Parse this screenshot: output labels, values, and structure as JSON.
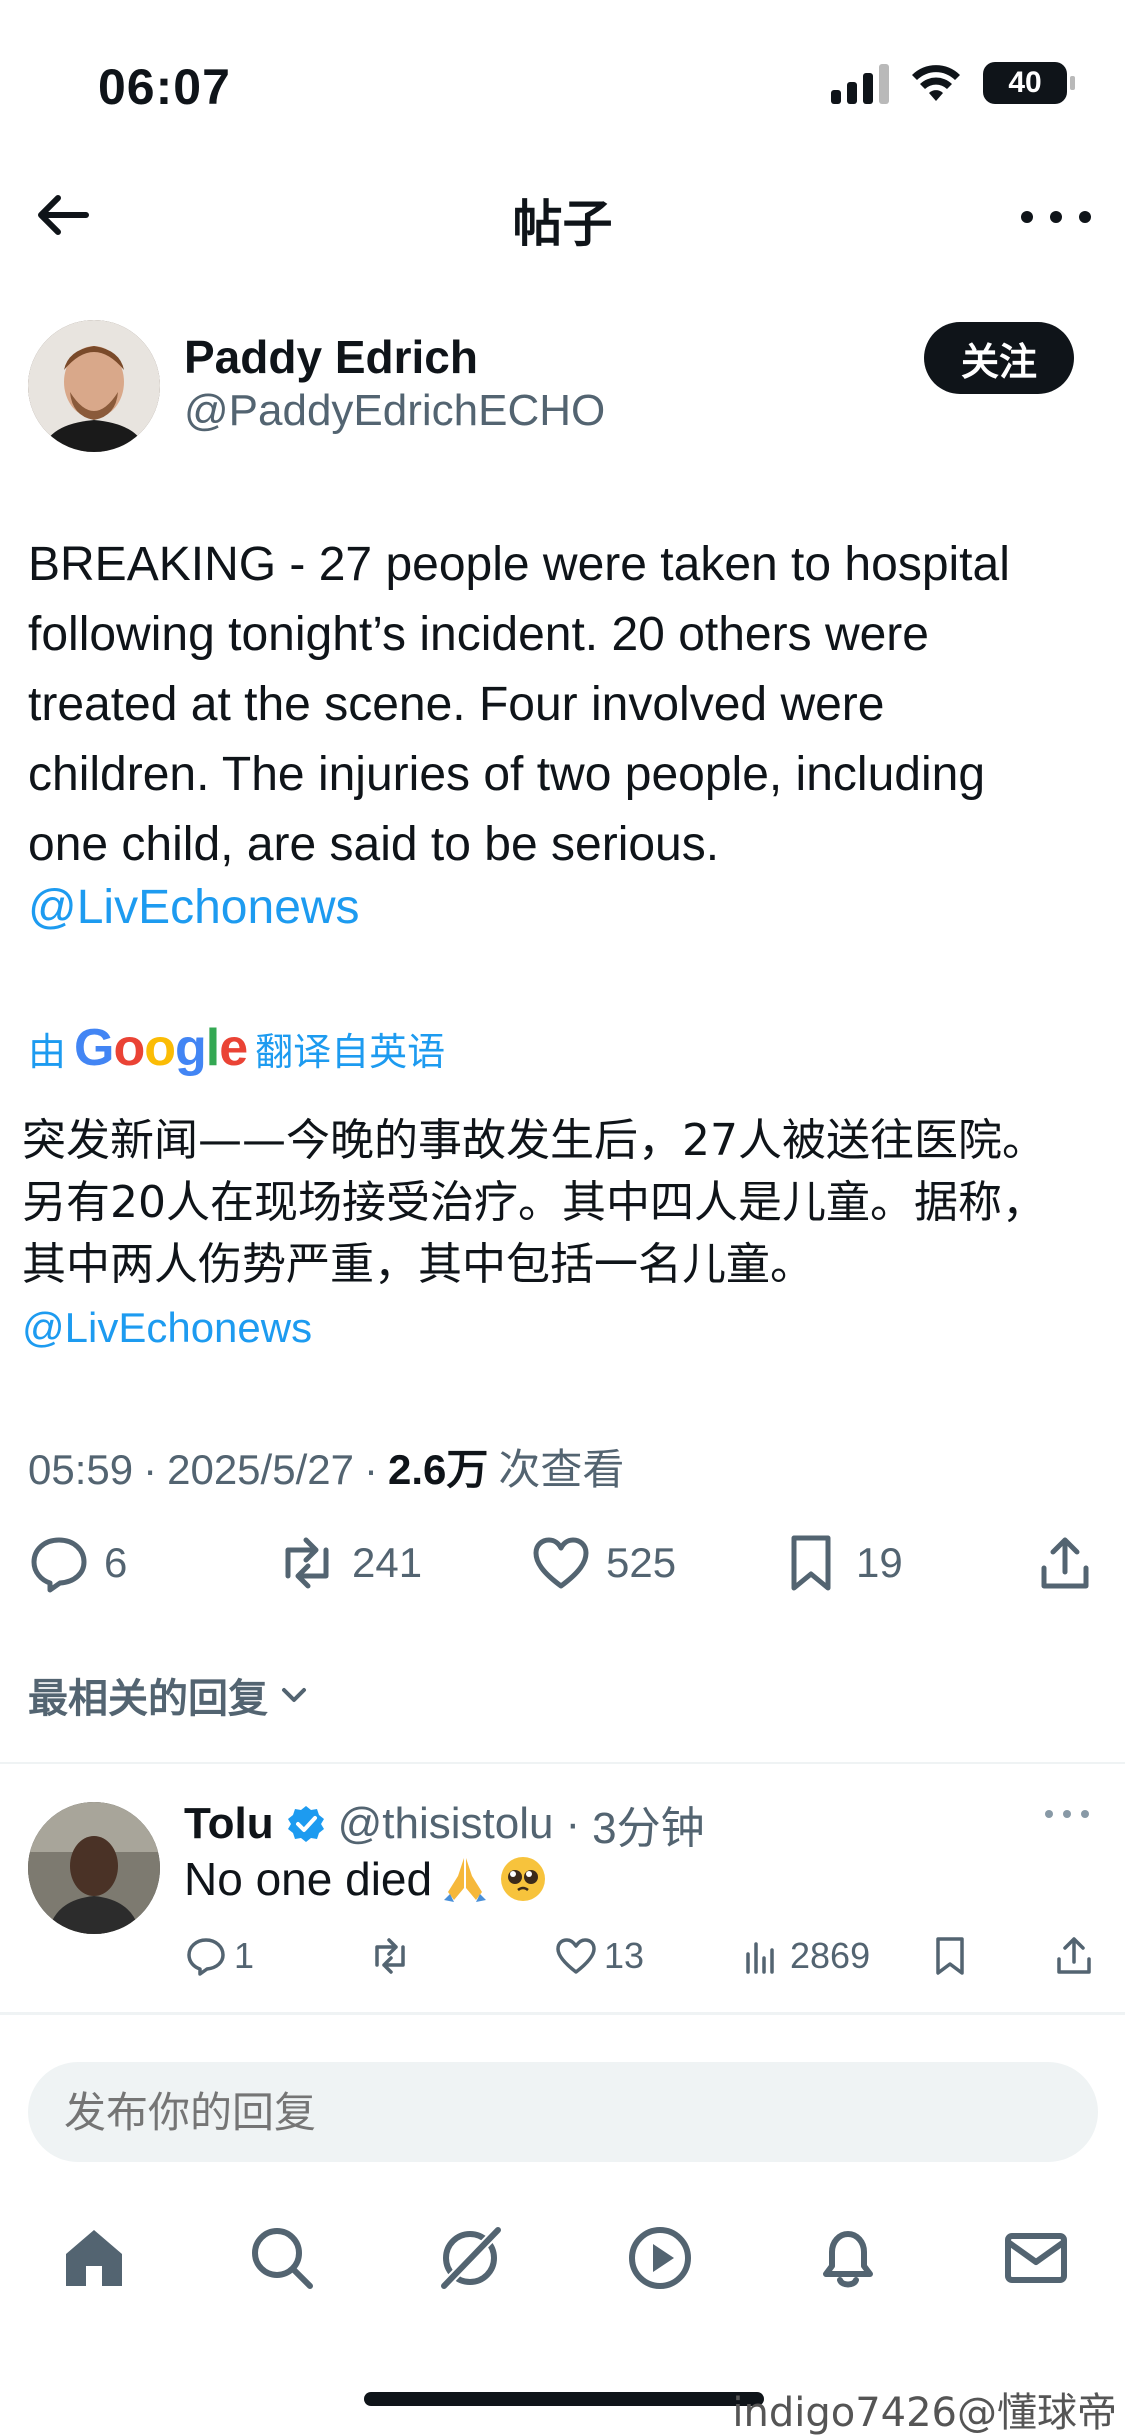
{
  "status_bar": {
    "time": "06:07",
    "battery": "40"
  },
  "header": {
    "title": "帖子"
  },
  "author": {
    "name": "Paddy Edrich",
    "handle": "@PaddyEdrichECHO",
    "follow_label": "关注"
  },
  "tweet": {
    "lines": [
      "BREAKING - 27 people were taken to hospital",
      "following tonight’s incident. 20 others were",
      "treated at the scene. Four involved were",
      "children. The injuries of two people, including",
      "one child, are said to be serious."
    ],
    "mention": "@LivEchonews",
    "translate_prefix": "由",
    "translate_brand": "Google",
    "translate_suffix": "翻译自英语",
    "translated_lines": [
      "突发新闻——今晚的事故发生后，27人被送往医院。",
      "另有20人在现场接受治疗。其中四人是儿童。据称，",
      "其中两人伤势严重，其中包括一名儿童。"
    ],
    "translated_mention": "@LivEchonews",
    "time": "05:59",
    "date": "2025/5/27",
    "sep": "·",
    "views": "2.6万",
    "views_label": "次查看"
  },
  "actions": {
    "replies": "6",
    "retweets": "241",
    "likes": "525",
    "bookmarks": "19"
  },
  "replies_section": {
    "label": "最相关的回复"
  },
  "reply": {
    "name": "Tolu",
    "handle": "@thisistolu",
    "sep": "·",
    "time": "3分钟",
    "text": "No one died",
    "replies": "1",
    "likes": "13",
    "views": "2869"
  },
  "compose": {
    "placeholder": "发布你的回复"
  },
  "watermark": "indigo7426@懂球帝",
  "colors": {
    "accent": "#1d9bf0",
    "text": "#0f1419",
    "muted": "#536471"
  }
}
